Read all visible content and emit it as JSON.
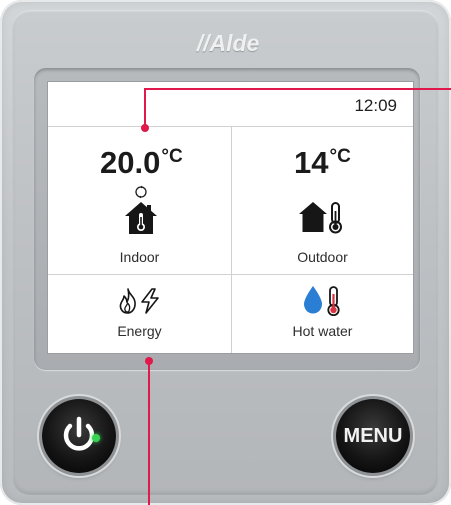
{
  "brand": {
    "logo_text": "//Alde"
  },
  "status_bar": {
    "time": "12:09"
  },
  "tiles": {
    "indoor": {
      "temp_value": "20.0",
      "unit": "°C",
      "label": "Indoor"
    },
    "outdoor": {
      "temp_value": "14",
      "unit": "°C",
      "label": "Outdoor"
    },
    "energy": {
      "label": "Energy"
    },
    "hot_water": {
      "label": "Hot water"
    }
  },
  "buttons": {
    "menu_label": "MENU"
  },
  "colors": {
    "callout": "#e0184c",
    "led": "#39d353",
    "water_blue": "#2a7fd4",
    "thermo_red": "#d9333f"
  },
  "icons": [
    "house-thermometer-icon",
    "house-outdoor-thermometer-icon",
    "flame-bolt-icon",
    "water-drop-thermometer-icon",
    "power-icon",
    "sync-icon"
  ]
}
